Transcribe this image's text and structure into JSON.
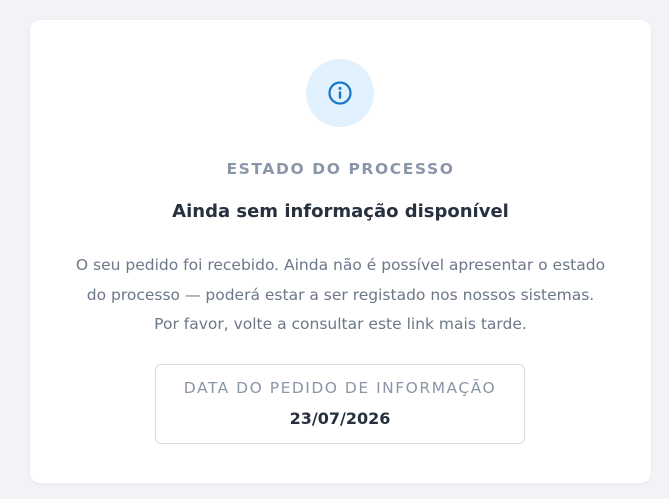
{
  "status_card": {
    "icon": "info-icon",
    "accent_color": "#1677c9",
    "icon_background": "#e1f1fd",
    "eyebrow": "ESTADO DO PROCESSO",
    "title": "Ainda sem informação disponível",
    "message_lines": [
      "O seu pedido foi recebido. Ainda não é possível apresentar o estado",
      "do processo — poderá estar a ser registado nos nossos sistemas.",
      "Por favor, volte a consultar este link mais tarde."
    ],
    "request_date": {
      "label": "DATA DO PEDIDO DE INFORMAÇÃO",
      "value": "23/07/2026"
    }
  }
}
